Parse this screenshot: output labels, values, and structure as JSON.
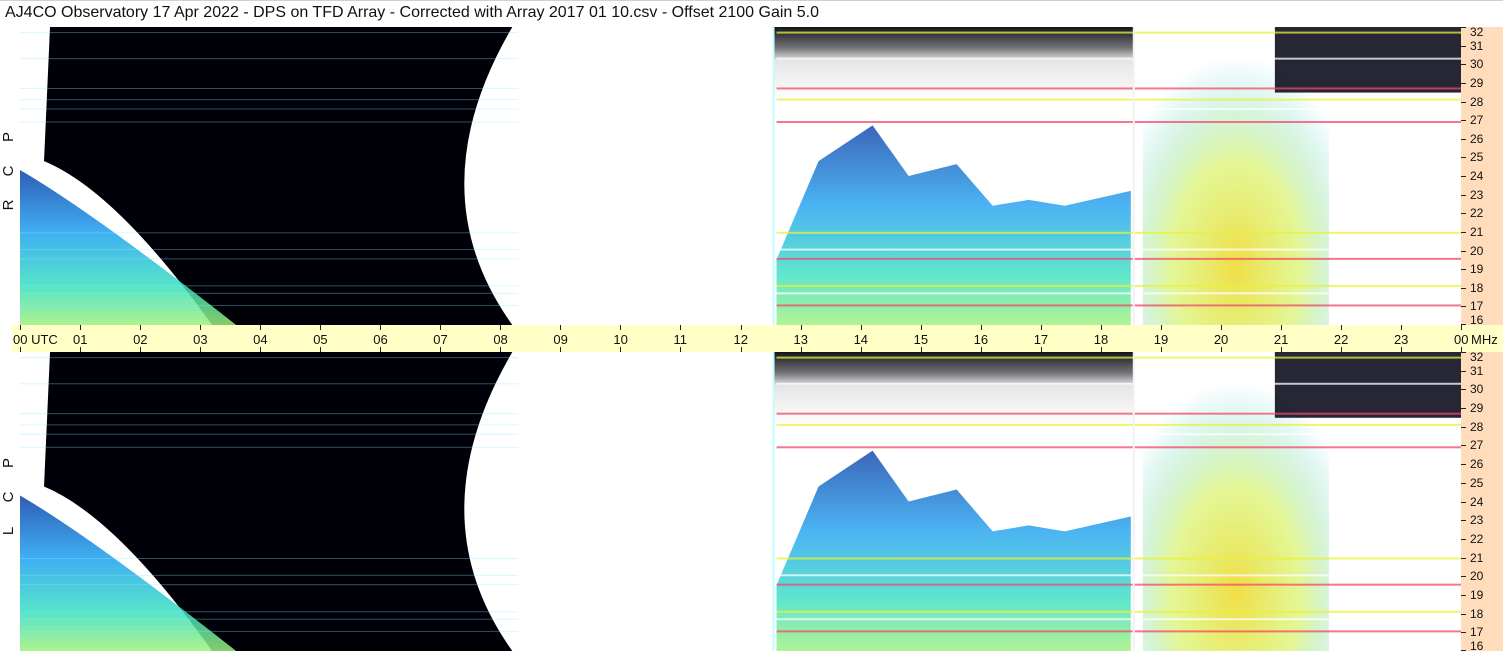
{
  "header": {
    "title": "AJ4CO Observatory  17 Apr 2022  -  DPS on TFD Array  -  Corrected with Array 2017 01 10.csv  -  Offset 2100  Gain 5.0"
  },
  "colors": {
    "background": "#000008",
    "low": "#0a3ea8",
    "mid": "#1e9cff",
    "high": "#2fe0d8",
    "peak": "#e8f03a",
    "hot": "#f04a6a",
    "time_axis_bg": "#ffffc6",
    "freq_axis_bg": "#ffdcbc"
  },
  "chart_data": {
    "type": "heatmap",
    "title": "AJ4CO Observatory  17 Apr 2022  -  DPS on TFD Array  -  Corrected with Array 2017 01 10.csv  -  Offset 2100  Gain 5.0",
    "xlabel": "UTC",
    "ylabel": "MHz",
    "x_ticks": [
      "00",
      "01",
      "02",
      "03",
      "04",
      "05",
      "06",
      "07",
      "08",
      "09",
      "10",
      "11",
      "12",
      "13",
      "14",
      "15",
      "16",
      "17",
      "18",
      "19",
      "20",
      "21",
      "22",
      "23",
      "00"
    ],
    "x_first_label": "00  UTC",
    "y_ticks": [
      "16",
      "17",
      "18",
      "19",
      "20",
      "21",
      "22",
      "23",
      "24",
      "25",
      "26",
      "27",
      "28",
      "29",
      "30",
      "31",
      "32"
    ],
    "y_unit": "MHz",
    "xlim": [
      0,
      24
    ],
    "ylim": [
      16,
      32
    ],
    "vertical_markers_utc": [
      12.55,
      18.55
    ],
    "panels": [
      {
        "name": "R C P",
        "letters": [
          "R",
          "C",
          "P"
        ]
      },
      {
        "name": "L C P",
        "letters": [
          "L",
          "C",
          "P"
        ]
      }
    ],
    "bands_mhz": [
      17.05,
      17.7,
      18.1,
      19.55,
      20.05,
      20.95,
      26.9,
      27.6,
      28.1,
      28.7,
      30.3,
      31.7
    ]
  }
}
